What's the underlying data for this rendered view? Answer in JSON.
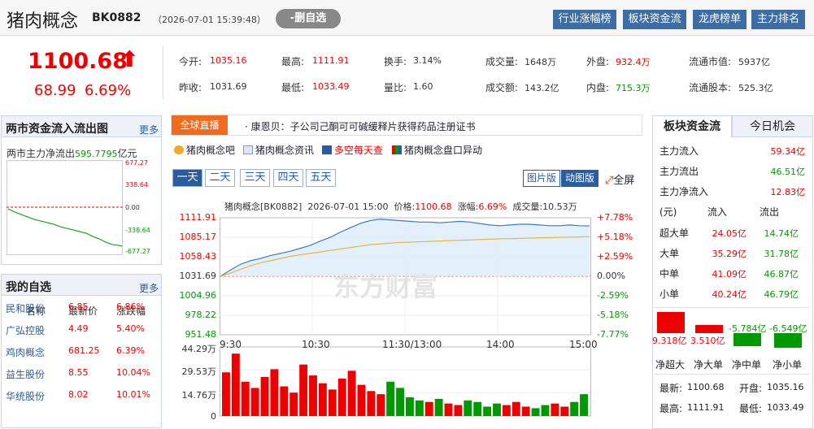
{
  "header": {
    "title": "猪肉概念",
    "code": "BK0882",
    "time": "（2026-07-01 15:39:48）",
    "del_btn": "-删自选",
    "buttons": [
      "行业涨幅榜",
      "板块资金流",
      "龙虎榜单",
      "主力排名"
    ]
  },
  "quote": {
    "price": "1100.68",
    "arrow": "⬆",
    "change": "68.99",
    "change_pct": "6.69%",
    "row1": [
      {
        "label": "今开:",
        "value": "1035.16",
        "color": "red"
      },
      {
        "label": "最高:",
        "value": "1111.91",
        "color": "red"
      },
      {
        "label": "换手:",
        "value": "3.14%",
        "color": "blk"
      },
      {
        "label": "成交量:",
        "value": "1648万",
        "color": "blk"
      },
      {
        "label": "外盘:",
        "value": "932.4万",
        "color": "red"
      },
      {
        "label": "流通市值:",
        "value": "5937亿",
        "color": "blk"
      }
    ],
    "row2": [
      {
        "label": "昨收:",
        "value": "1031.69",
        "color": "blk"
      },
      {
        "label": "最低:",
        "value": "1033.49",
        "color": "red"
      },
      {
        "label": "量比:",
        "value": "1.60",
        "color": "blk"
      },
      {
        "label": "成交额:",
        "value": "143.2亿",
        "color": "blk"
      },
      {
        "label": "内盘:",
        "value": "715.3万",
        "color": "grn"
      },
      {
        "label": "流通股本:",
        "value": "525.3亿",
        "color": "blk"
      }
    ]
  },
  "flow_panel": {
    "title": "两市资金流入流出图",
    "more": "更多",
    "label": "两市主力净流出",
    "value": "595.7795",
    "unit": "亿元",
    "ticks": [
      "677.27",
      "338.64",
      "0.00",
      "-338.64",
      "-677.27"
    ]
  },
  "watchlist": {
    "title": "我的自选",
    "more": "更多",
    "headers": [
      "名称",
      "最新价",
      "涨跌幅"
    ],
    "rows": [
      {
        "name": "民和股份",
        "price": "6.85",
        "pct": "6.86%"
      },
      {
        "name": "广弘控股",
        "price": "4.49",
        "pct": "5.40%"
      },
      {
        "name": "鸡肉概念",
        "price": "681.25",
        "pct": "6.39%"
      },
      {
        "name": "益生股份",
        "price": "8.55",
        "pct": "10.04%"
      },
      {
        "name": "华统股份",
        "price": "8.02",
        "pct": "10.01%"
      }
    ]
  },
  "news": {
    "tag": "全球直播",
    "text": "· 康恩贝：子公司己酮可可碱缓释片获得药品注册证书"
  },
  "links": [
    "猪肉概念吧",
    "猪肉概念资讯",
    "多空每天查",
    "猪肉概念盘口异动"
  ],
  "period_tabs": [
    "一天",
    "二天",
    "三天",
    "四天",
    "五天"
  ],
  "view_btns": [
    "图片版",
    "动图版"
  ],
  "fullscreen": "全屏",
  "chart_info": {
    "name": "猪肉概念[BK0882]",
    "date": "2026-07-01 15:00",
    "price_label": "价格:",
    "price": "1100.68",
    "pct_label": "涨幅:",
    "pct": "6.69%",
    "vol_label": "成交量:",
    "vol": "10.53万"
  },
  "watermark": "东方财富",
  "chart_data": {
    "type": "line",
    "title": "猪肉概念[BK0882]",
    "prev_close": 1031.69,
    "ylim": [
      951.48,
      1111.91
    ],
    "y_ticks": [
      "1111.91",
      "1085.17",
      "1058.43",
      "1031.69",
      "1004.96",
      "978.22",
      "951.48"
    ],
    "pct_ticks": [
      "+7.78%",
      "+5.18%",
      "+2.59%",
      "0.00%",
      "-2.59%",
      "-5.18%",
      "-7.77%"
    ],
    "x_ticks": [
      "9:30",
      "10:30",
      "11:30/13:00",
      "14:00",
      "15:00"
    ],
    "vol_ticks": [
      "44.29万",
      "29.53万",
      "14.76万",
      "0"
    ],
    "series": [
      {
        "name": "价格",
        "values": [
          1031.7,
          1040,
          1048,
          1053,
          1056,
          1060,
          1063,
          1066,
          1070,
          1074,
          1080,
          1085,
          1092,
          1098,
          1104,
          1108,
          1110,
          1109,
          1108,
          1107,
          1106,
          1106,
          1105,
          1106,
          1107,
          1106,
          1104,
          1102,
          1101,
          1102,
          1103,
          1103,
          1102,
          1101,
          1101,
          1102,
          1101,
          1100.68
        ]
      },
      {
        "name": "均价",
        "values": [
          1031.7,
          1036,
          1041,
          1046,
          1050,
          1053,
          1056,
          1059,
          1061,
          1063,
          1065,
          1067,
          1069,
          1071,
          1073,
          1075,
          1076,
          1077,
          1078,
          1078.5,
          1079,
          1079.5,
          1080,
          1080.5,
          1081,
          1081.5,
          1082,
          1082.5,
          1083,
          1083.3,
          1083.6,
          1084,
          1084.3,
          1084.6,
          1085,
          1085.3,
          1085.6,
          1086
        ]
      }
    ],
    "volume": [
      28,
      40,
      22,
      18,
      25,
      30,
      19,
      15,
      33,
      26,
      21,
      17,
      24,
      29,
      20,
      16,
      14,
      22,
      18,
      12,
      10,
      9,
      11,
      8,
      7,
      10,
      9,
      6,
      8,
      7,
      9,
      6,
      5,
      7,
      8,
      6,
      9,
      14
    ]
  },
  "fund_tabs": [
    "板块资金流",
    "今日机会"
  ],
  "fund": {
    "rows": [
      {
        "label": "主力流入",
        "value": "59.34亿",
        "color": "red"
      },
      {
        "label": "主力流出",
        "value": "46.51亿",
        "color": "grn"
      },
      {
        "label": "主力净流入",
        "value": "12.83亿",
        "color": "red"
      }
    ],
    "headers": [
      "(元)",
      "流入",
      "流出"
    ],
    "detail": [
      {
        "label": "超大单",
        "in": "24.05亿",
        "out": "14.74亿"
      },
      {
        "label": "大单",
        "in": "35.29亿",
        "out": "31.78亿"
      },
      {
        "label": "中单",
        "in": "41.09亿",
        "out": "46.87亿"
      },
      {
        "label": "小单",
        "in": "40.24亿",
        "out": "46.79亿"
      }
    ],
    "net_bars": [
      {
        "label": "净超大",
        "value": "9.318亿",
        "num": 9.318
      },
      {
        "label": "净大单",
        "value": "3.510亿",
        "num": 3.51
      },
      {
        "label": "净中单",
        "value": "-5.784亿",
        "num": -5.784
      },
      {
        "label": "净小单",
        "value": "-6.549亿",
        "num": -6.549
      }
    ],
    "bottom": [
      {
        "label": "最新:",
        "value": "1100.68"
      },
      {
        "label": "开盘:",
        "value": "1035.16"
      },
      {
        "label": "最高:",
        "value": "1111.91"
      },
      {
        "label": "最低:",
        "value": "1033.49"
      }
    ]
  },
  "colors": {
    "red": "#e00000",
    "green": "#009900",
    "blue": "#2a5d9f",
    "orange": "#f26b1d"
  }
}
